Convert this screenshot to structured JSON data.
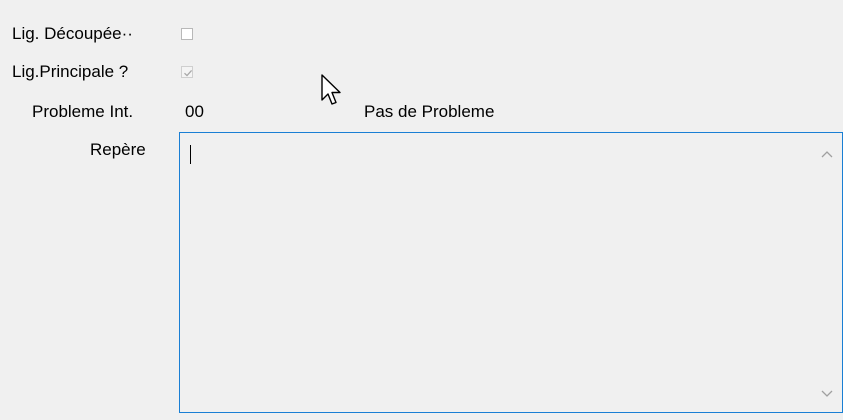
{
  "form": {
    "lig_decoupee_label": "Lig. Découpée··",
    "lig_decoupee_checked": false,
    "lig_principale_label": "Lig.Principale ?",
    "lig_principale_checked": true,
    "probleme_label": "Probleme Int.",
    "probleme_code": "00",
    "probleme_text": "Pas de Probleme",
    "repere_label": "Repère",
    "repere_value": ""
  },
  "colors": {
    "background": "#f0f0f0",
    "memo_border": "#1a7fd4",
    "scroll_arrow": "#a0a0a0"
  },
  "icons": [
    "check-icon",
    "mouse-cursor-icon",
    "scroll-up-icon",
    "scroll-down-icon"
  ]
}
